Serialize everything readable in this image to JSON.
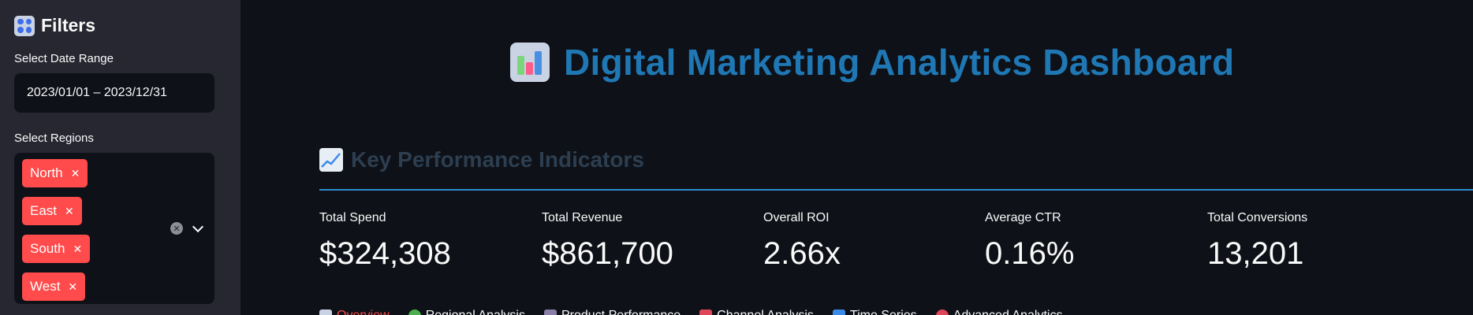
{
  "sidebar": {
    "title": "Filters",
    "date_label": "Select Date Range",
    "date_value": "2023/01/01 – 2023/12/31",
    "regions_label": "Select Regions",
    "regions": [
      "North",
      "East",
      "South",
      "West"
    ]
  },
  "main": {
    "title": "Digital Marketing Analytics Dashboard",
    "kpi_header": "Key Performance Indicators",
    "metrics": [
      {
        "label": "Total Spend",
        "value": "$324,308"
      },
      {
        "label": "Total Revenue",
        "value": "$861,700"
      },
      {
        "label": "Overall ROI",
        "value": "2.66x"
      },
      {
        "label": "Average CTR",
        "value": "0.16%"
      },
      {
        "label": "Total Conversions",
        "value": "13,201"
      }
    ],
    "tabs": [
      {
        "label": "Overview",
        "icon": "bar-chart-icon"
      },
      {
        "label": "Regional Analysis",
        "icon": "globe-icon"
      },
      {
        "label": "Product Performance",
        "icon": "calendar-icon"
      },
      {
        "label": "Channel Analysis",
        "icon": "megaphone-icon"
      },
      {
        "label": "Time Series",
        "icon": "chart-icon"
      },
      {
        "label": "Advanced Analytics",
        "icon": "refresh-icon"
      }
    ]
  },
  "colors": {
    "accent": "#ff4b4b",
    "title_blue": "#1f77b4",
    "sidebar_bg": "#262730",
    "main_bg": "#0e1117"
  }
}
